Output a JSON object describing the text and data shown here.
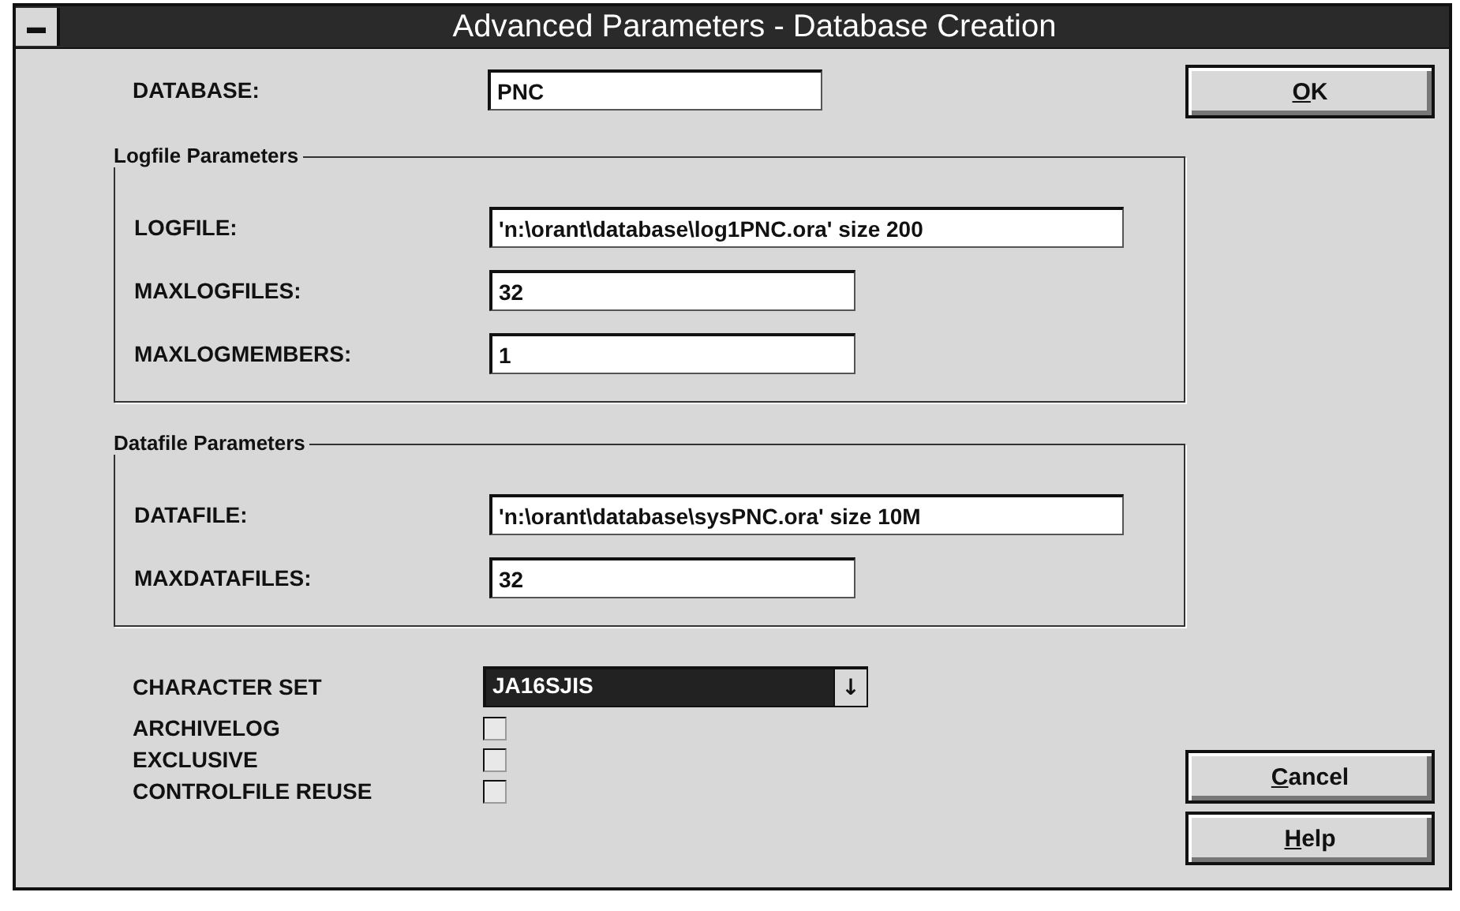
{
  "window": {
    "title": "Advanced Parameters - Database Creation",
    "system_menu": "▬"
  },
  "database": {
    "label": "DATABASE:",
    "value": "PNC"
  },
  "logfile_group": {
    "title": "Logfile Parameters",
    "fields": [
      {
        "label": "LOGFILE:",
        "value": "'n:\\orant\\database\\log1PNC.ora' size 200",
        "kind": "wide"
      },
      {
        "label": "MAXLOGFILES:",
        "value": "32",
        "kind": "short"
      },
      {
        "label": "MAXLOGMEMBERS:",
        "value": "1",
        "kind": "short"
      }
    ]
  },
  "datafile_group": {
    "title": "Datafile Parameters",
    "fields": [
      {
        "label": "DATAFILE:",
        "value": "'n:\\orant\\database\\sysPNC.ora' size 10M",
        "kind": "wide"
      },
      {
        "label": "MAXDATAFILES:",
        "value": "32",
        "kind": "short"
      }
    ]
  },
  "character_set": {
    "label": "CHARACTER SET",
    "value": "JA16SJIS",
    "selected": true,
    "arrow": "↓"
  },
  "options": [
    {
      "label": "ARCHIVELOG",
      "checked": false
    },
    {
      "label": "EXCLUSIVE",
      "checked": false
    },
    {
      "label": "CONTROLFILE REUSE",
      "checked": false
    }
  ],
  "top_buttons": [
    {
      "label": "OK"
    }
  ],
  "bottom_buttons": [
    {
      "label": "Cancel"
    },
    {
      "label": "Help"
    }
  ]
}
